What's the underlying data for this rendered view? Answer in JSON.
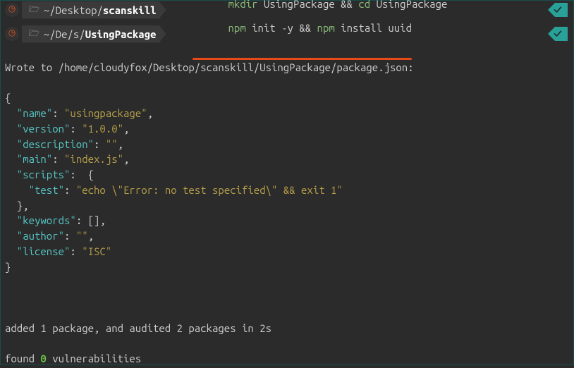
{
  "prompt1": {
    "path_prefix": "~/Desktop/",
    "path_bold": "scanskill",
    "cmd1": "mkdir",
    "arg1": " UsingPackage ",
    "op1": "&&",
    "cmd2": " cd",
    "arg2": " UsingPackage"
  },
  "prompt2": {
    "path_prefix": "~/De/s/",
    "path_bold": "UsingPackage",
    "cmd1": "npm",
    "arg1": " init -y ",
    "op1": "&&",
    "cmd2": " npm",
    "arg2": " install uuid"
  },
  "out": {
    "line1": "Wrote to /home/cloudyfox/Desktop/scanskill/UsingPackage/package.json:",
    "brace_open": "{",
    "k_name": "  \"name\"",
    "v_name": "\"usingpackage\"",
    "k_version": "  \"version\"",
    "v_version": "\"1.0.0\"",
    "k_desc": "  \"description\"",
    "v_desc": "\"\"",
    "k_main": "  \"main\"",
    "v_main": "\"index.js\"",
    "k_scripts": "  \"scripts\"",
    "k_test": "    \"test\"",
    "v_test": "\"echo \\\"Error: no test specified\\\" && exit 1\"",
    "brace_close_s": "  }",
    "k_keywords": "  \"keywords\"",
    "v_keywords": "[]",
    "k_author": "  \"author\"",
    "v_author": "\"\"",
    "k_license": "  \"license\"",
    "v_license": "\"ISC\"",
    "brace_close": "}",
    "added": "added 1 package, and audited 2 packages in 2s",
    "found_pre": "found ",
    "found_n": "0",
    "found_post": " vulnerabilities"
  },
  "punct": {
    "colon_sp": ": ",
    "comma": ",",
    "brace_open": " {"
  }
}
